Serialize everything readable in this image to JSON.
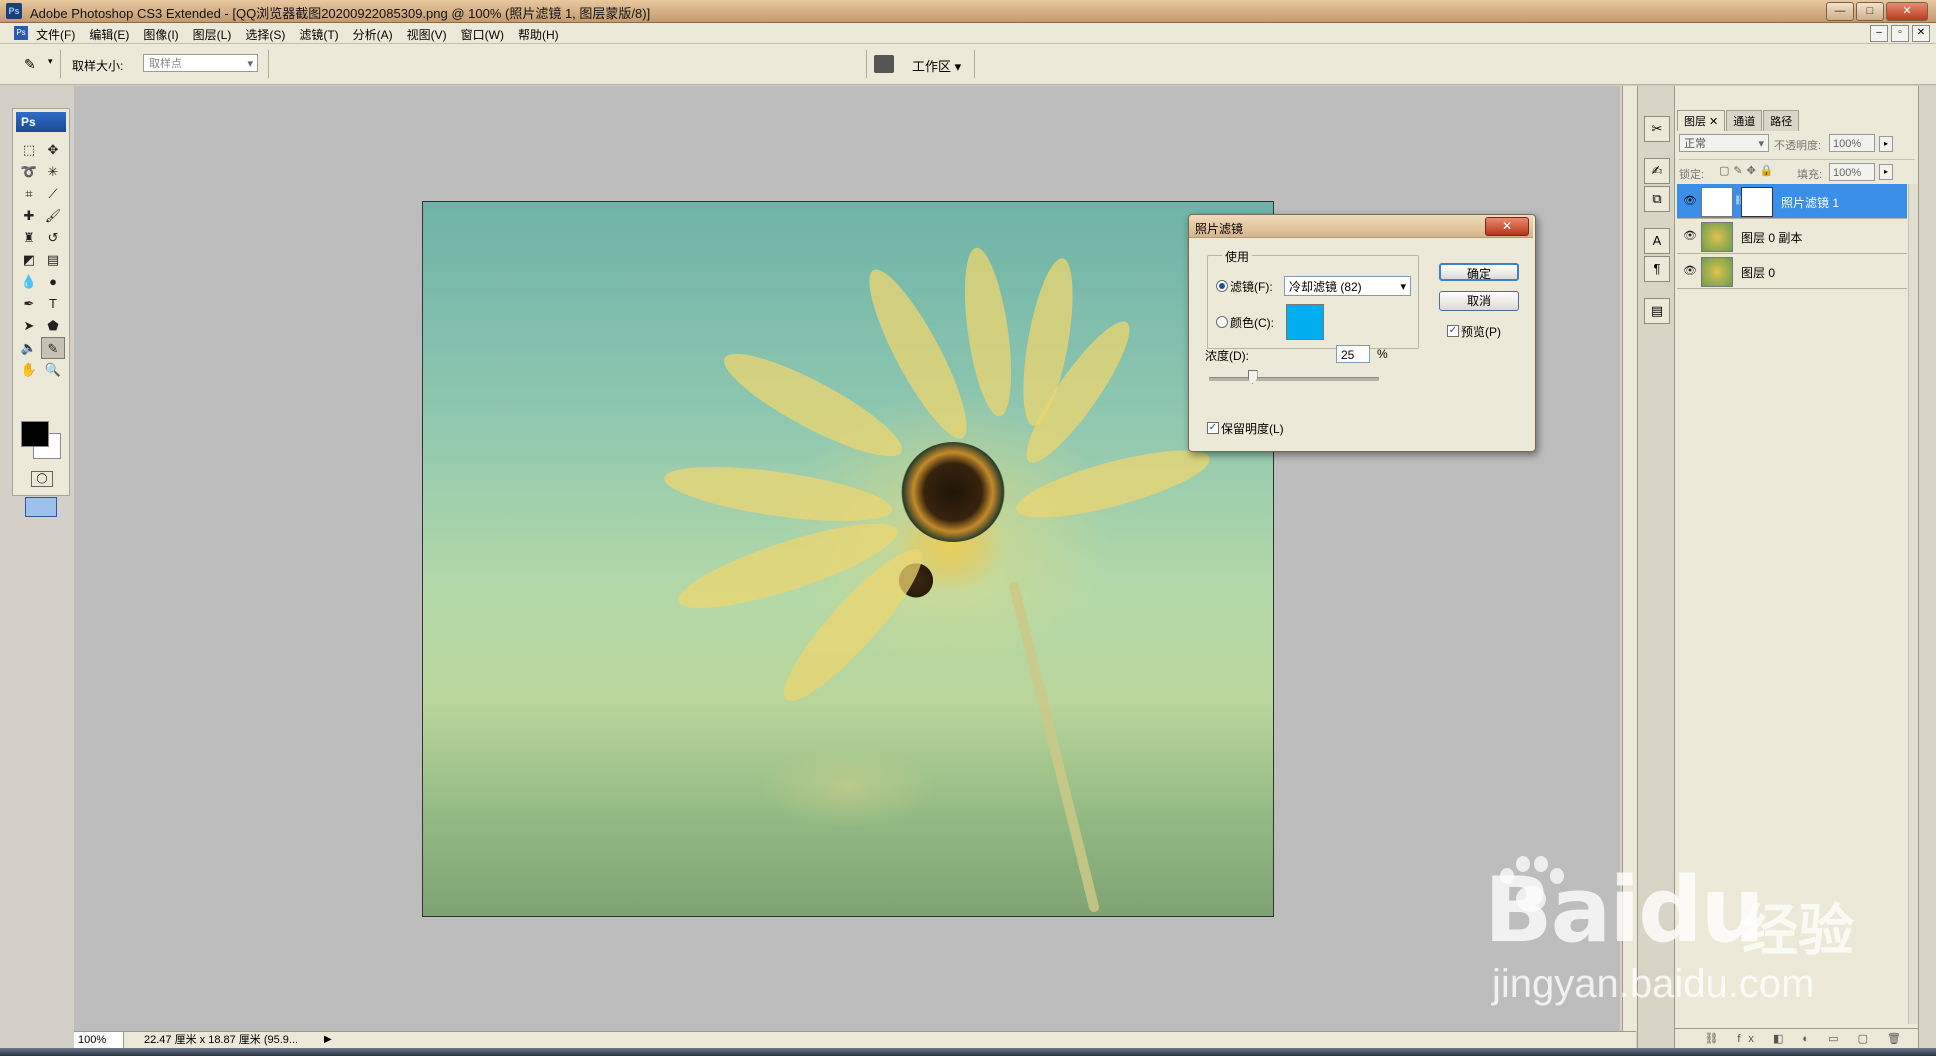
{
  "window": {
    "title": "Adobe Photoshop CS3 Extended - [QQ浏览器截图20200922085309.png @ 100% (照片滤镜 1, 图层蒙版/8)]",
    "app_badge": "Ps",
    "doc_badge": "Ps"
  },
  "menu": [
    "文件(F)",
    "编辑(E)",
    "图像(I)",
    "图层(L)",
    "选择(S)",
    "滤镜(T)",
    "分析(A)",
    "视图(V)",
    "窗口(W)",
    "帮助(H)"
  ],
  "options": {
    "sample_size_label": "取样大小:",
    "sample_size_value": "取样点",
    "workspace_label": "工作区 ▾"
  },
  "toolbox": {
    "badge": "Ps"
  },
  "status": {
    "zoom": "100%",
    "doc_size": "22.47 厘米 x 18.87 厘米 (95.9..."
  },
  "dialog": {
    "title": "照片滤镜",
    "close": "✕",
    "group_label": "使用",
    "filter_label": "滤镜(F):",
    "filter_value": "冷却滤镜 (82)",
    "color_label": "颜色(C):",
    "color_value": "#00aeef",
    "density_label": "浓度(D):",
    "density_value": "25",
    "density_unit": "%",
    "density_level": 0.25,
    "preserve_label": "保留明度(L)",
    "preview_label": "预览(P)",
    "ok_label": "确定",
    "cancel_label": "取消"
  },
  "layers_panel": {
    "tabs": [
      "图层",
      "通道",
      "路径"
    ],
    "blend_mode": "正常",
    "opacity_label": "不透明度:",
    "opacity_value": "100%",
    "lock_label": "锁定:",
    "fill_label": "填充:",
    "fill_value": "100%",
    "layers": [
      {
        "name": "照片滤镜 1",
        "selected": true,
        "adjustment": true
      },
      {
        "name": "图层 0 副本",
        "selected": false,
        "adjustment": false
      },
      {
        "name": "图层 0",
        "selected": false,
        "adjustment": false
      }
    ]
  },
  "watermark": {
    "logo": "Baidu",
    "cn": "经验",
    "url": "jingyan.baidu.com"
  }
}
